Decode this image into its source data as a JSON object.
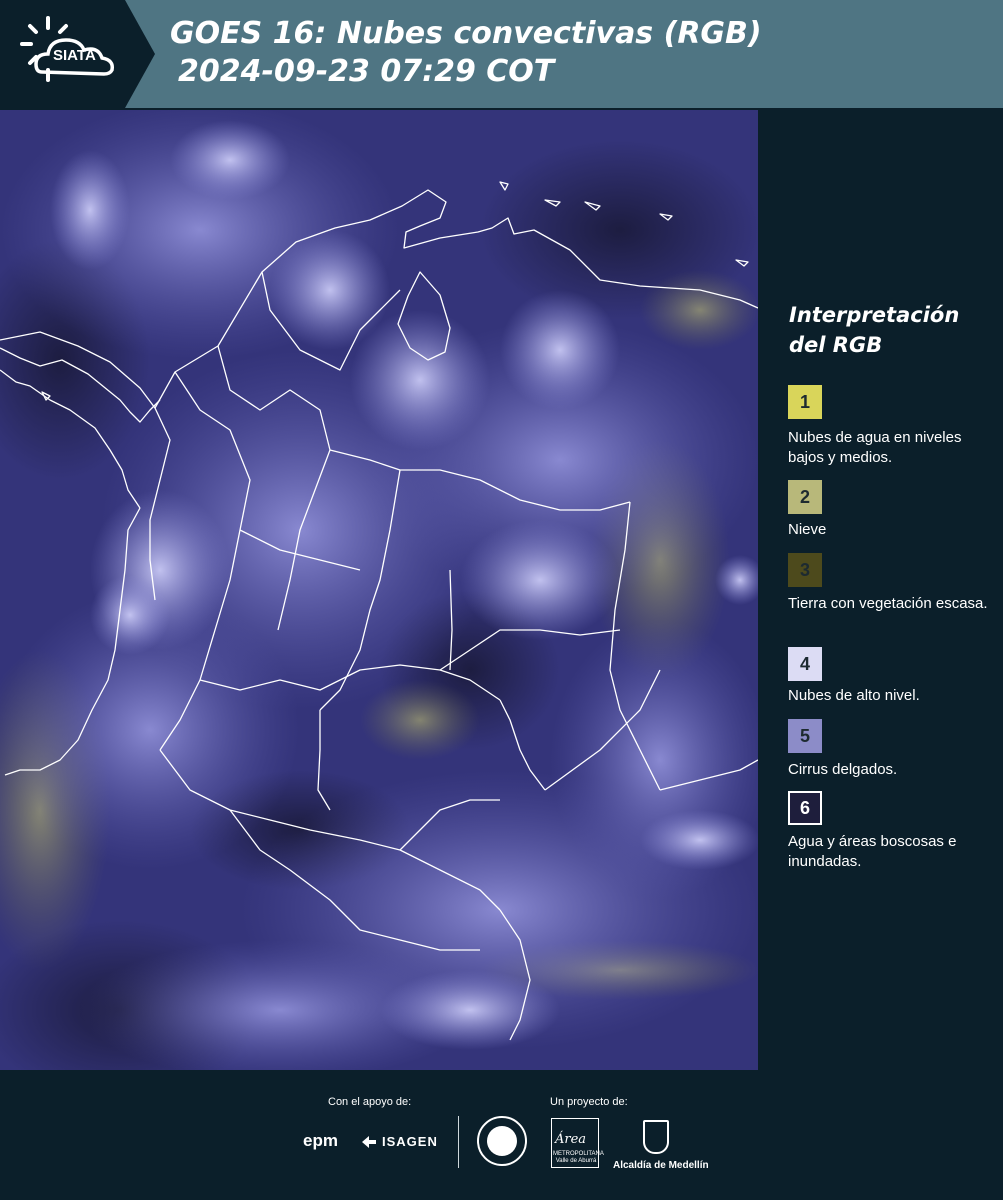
{
  "header": {
    "logo_text": "SIATA",
    "title_line1": "GOES 16: Nubes convectivas (RGB)",
    "title_line2": "2024-09-23 07:29 COT"
  },
  "legend": {
    "title": "Interpretación del RGB",
    "items": [
      {
        "number": "1",
        "label": "Nubes de agua en niveles bajos y medios.",
        "color": "#d9d55a"
      },
      {
        "number": "2",
        "label": "Nieve",
        "color": "#b8b87a"
      },
      {
        "number": "3",
        "label": "Tierra con vegetación escasa.",
        "color": "#4d4a1c"
      },
      {
        "number": "4",
        "label": "Nubes de alto nivel.",
        "color": "#dcdcf4"
      },
      {
        "number": "5",
        "label": "Cirrus delgados.",
        "color": "#8c8cc8"
      },
      {
        "number": "6",
        "label": "Agua y áreas boscosas e inundadas.",
        "color": "#1e1e3c"
      }
    ]
  },
  "footer": {
    "support_label": "Con el apoyo de:",
    "project_label": "Un proyecto de:",
    "sponsor_1": "epm",
    "sponsor_2": "ISAGEN",
    "partner_area": "Área",
    "partner_area_sub": "METROPOLITANA Valle de Aburrá",
    "partner_medellin": "Alcaldía de Medellín"
  },
  "icons": {
    "logo": "sun-cloud-icon",
    "seal": "municipal-seal-icon",
    "shield": "coat-of-arms-icon"
  }
}
